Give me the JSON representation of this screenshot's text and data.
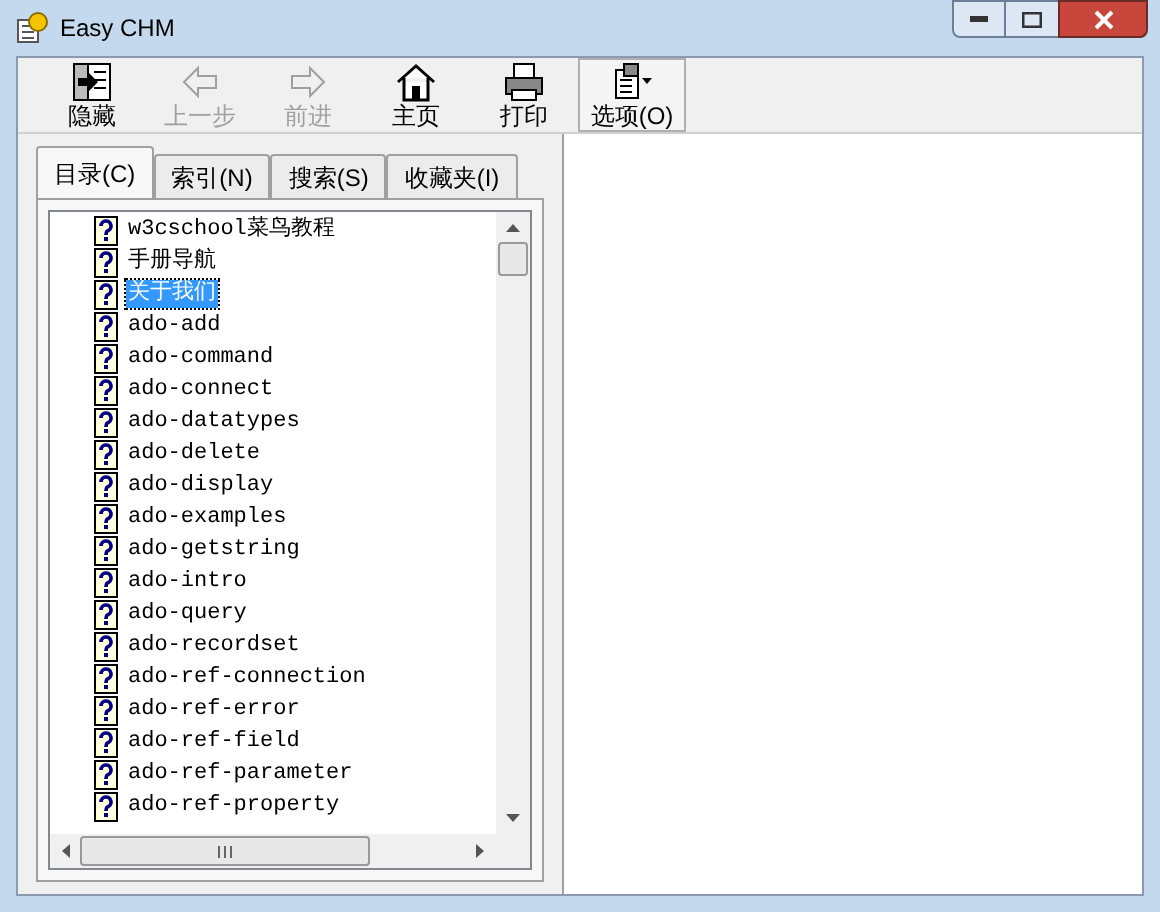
{
  "window": {
    "title": "Easy CHM"
  },
  "toolbar": [
    {
      "kind": "hide",
      "label": "隐藏",
      "disabled": false
    },
    {
      "kind": "back",
      "label": "上一步",
      "disabled": true
    },
    {
      "kind": "forward",
      "label": "前进",
      "disabled": true
    },
    {
      "kind": "home",
      "label": "主页",
      "disabled": false
    },
    {
      "kind": "print",
      "label": "打印",
      "disabled": false
    },
    {
      "kind": "options",
      "label": "选项(O)",
      "disabled": false
    }
  ],
  "tabs": [
    {
      "label": "目录(C)",
      "selected": true
    },
    {
      "label": "索引(N)",
      "selected": false
    },
    {
      "label": "搜索(S)",
      "selected": false
    },
    {
      "label": "收藏夹(I)",
      "selected": false
    }
  ],
  "tree": {
    "items": [
      {
        "label": "w3cschool菜鸟教程",
        "selected": false
      },
      {
        "label": "手册导航",
        "selected": false
      },
      {
        "label": "关于我们",
        "selected": true
      },
      {
        "label": "ado-add",
        "selected": false
      },
      {
        "label": "ado-command",
        "selected": false
      },
      {
        "label": "ado-connect",
        "selected": false
      },
      {
        "label": "ado-datatypes",
        "selected": false
      },
      {
        "label": "ado-delete",
        "selected": false
      },
      {
        "label": "ado-display",
        "selected": false
      },
      {
        "label": "ado-examples",
        "selected": false
      },
      {
        "label": "ado-getstring",
        "selected": false
      },
      {
        "label": "ado-intro",
        "selected": false
      },
      {
        "label": "ado-query",
        "selected": false
      },
      {
        "label": "ado-recordset",
        "selected": false
      },
      {
        "label": "ado-ref-connection",
        "selected": false
      },
      {
        "label": "ado-ref-error",
        "selected": false
      },
      {
        "label": "ado-ref-field",
        "selected": false
      },
      {
        "label": "ado-ref-parameter",
        "selected": false
      },
      {
        "label": "ado-ref-property",
        "selected": false
      }
    ]
  }
}
